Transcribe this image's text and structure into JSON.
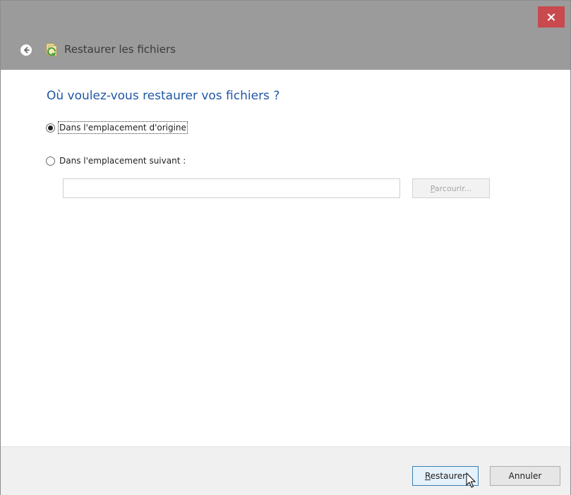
{
  "window": {
    "title": "Restaurer les fichiers",
    "close_glyph": "×"
  },
  "main": {
    "heading": "Où voulez-vous restaurer vos fichiers ?",
    "options": [
      {
        "label": "Dans l'emplacement d'origine",
        "checked": true
      },
      {
        "label": "Dans l'emplacement suivant :",
        "checked": false
      }
    ],
    "path_input": {
      "value": "",
      "placeholder": ""
    },
    "browse_label": "Parcourir..."
  },
  "footer": {
    "restore_label": "Restaurer",
    "cancel_label": "Annuler"
  },
  "icons": {
    "back": "back-arrow-icon",
    "app": "restore-files-icon",
    "close": "close-icon",
    "cursor": "mouse-pointer-icon"
  },
  "colors": {
    "titlebar": "#9b9b9b",
    "close": "#c84a4e",
    "heading": "#1f57a6",
    "primary_border": "#3c7fb1"
  }
}
